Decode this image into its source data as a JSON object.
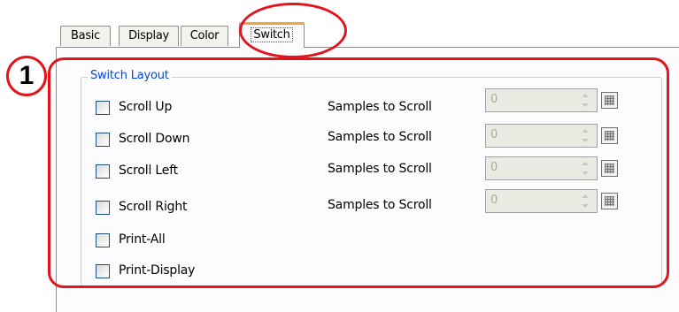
{
  "tabs": [
    {
      "label": "Basic",
      "active": false
    },
    {
      "label": "Display",
      "active": false
    },
    {
      "label": "Color",
      "active": false
    },
    {
      "label": "Switch",
      "active": true
    }
  ],
  "group": {
    "title": "Switch Layout"
  },
  "options": [
    {
      "label": "Scroll Up",
      "checked": false,
      "samples_label": "Samples to Scroll",
      "samples_value": "0",
      "samples_enabled": false
    },
    {
      "label": "Scroll Down",
      "checked": false,
      "samples_label": "Samples to Scroll",
      "samples_value": "0",
      "samples_enabled": false
    },
    {
      "label": "Scroll Left",
      "checked": false,
      "samples_label": "Samples to Scroll",
      "samples_value": "0",
      "samples_enabled": false
    },
    {
      "label": "Scroll Right",
      "checked": false,
      "samples_label": "Samples to Scroll",
      "samples_value": "0",
      "samples_enabled": false
    },
    {
      "label": "Print-All",
      "checked": false
    },
    {
      "label": "Print-Display",
      "checked": false
    }
  ],
  "annotation": {
    "badge_number": "1",
    "color": "#e2141c"
  },
  "colors": {
    "tab_accent": "#f3a33b",
    "group_title": "#0046d5",
    "checkbox_border": "#1c5180"
  },
  "icons": {
    "spin_buttons": "spin-arrows-icon",
    "picker_button": "grid-icon"
  }
}
